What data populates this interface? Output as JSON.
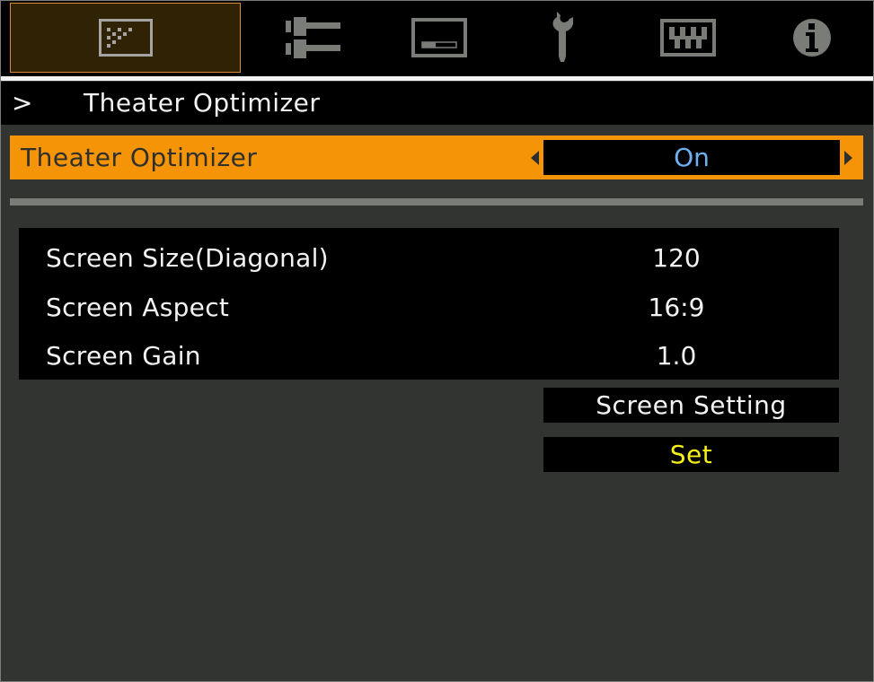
{
  "tabs": [
    {
      "name": "picture-adjust",
      "icon": "picture-adjust-icon",
      "active": true
    },
    {
      "name": "input-signal",
      "icon": "input-signal-icon",
      "active": false
    },
    {
      "name": "installation",
      "icon": "installation-icon",
      "active": false
    },
    {
      "name": "function",
      "icon": "wrench-icon",
      "active": false
    },
    {
      "name": "display-setup",
      "icon": "display-setup-icon",
      "active": false
    },
    {
      "name": "information",
      "icon": "info-icon",
      "active": false
    }
  ],
  "breadcrumb": {
    "arrow": ">",
    "title": "Theater Optimizer"
  },
  "option": {
    "label": "Theater Optimizer",
    "value": "On"
  },
  "screen_info": [
    {
      "label": "Screen Size(Diagonal)",
      "value": "120"
    },
    {
      "label": "Screen Aspect",
      "value": "16:9"
    },
    {
      "label": "Screen Gain",
      "value": "1.0"
    }
  ],
  "buttons": {
    "screen_setting": "Screen Setting",
    "set": "Set"
  },
  "colors": {
    "highlight": "#f59406",
    "value_text": "#6fb0f0",
    "set_text": "#f5f016",
    "panel_bg": "#323431",
    "active_tab_border": "#d98a3a"
  }
}
